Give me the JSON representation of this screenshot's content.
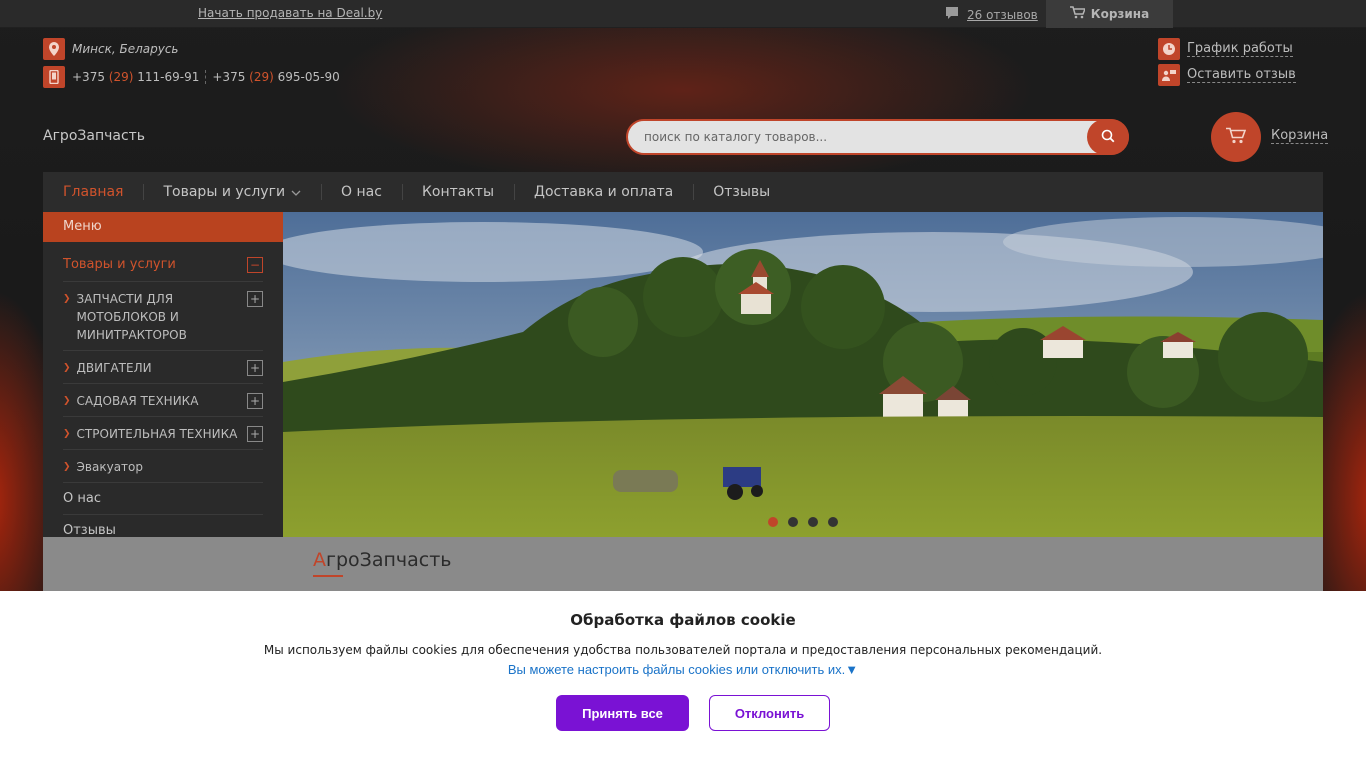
{
  "topbar": {
    "sell_link": "Начать продавать на Deal.by",
    "reviews_link": "26 отзывов",
    "cart": "Корзина"
  },
  "contacts": {
    "city": "Минск, Беларусь",
    "phone1_prefix": "+375",
    "phone1_code": "(29)",
    "phone1_number": "111-69-91",
    "phone2_prefix": "+375",
    "phone2_code": "(29)",
    "phone2_number": "695-05-90"
  },
  "links": {
    "schedule": "График работы",
    "leave_review": "Оставить отзыв"
  },
  "site_name": "АгроЗапчасть",
  "search": {
    "placeholder": "поиск по каталогу товаров..."
  },
  "cart_label": "Корзина",
  "nav": {
    "items": [
      {
        "label": "Главная"
      },
      {
        "label": "Товары и услуги"
      },
      {
        "label": "О нас"
      },
      {
        "label": "Контакты"
      },
      {
        "label": "Доставка и оплата"
      },
      {
        "label": "Отзывы"
      }
    ]
  },
  "sidebar": {
    "header": "Меню",
    "category": "Товары и услуги",
    "subitems": [
      {
        "label": "ЗАПЧАСТИ ДЛЯ МОТОБЛОКОВ И МИНИТРАКТОРОВ"
      },
      {
        "label": "ДВИГАТЕЛИ"
      },
      {
        "label": "САДОВАЯ ТЕХНИКА"
      },
      {
        "label": "СТРОИТЕЛЬНАЯ ТЕХНИКА"
      },
      {
        "label": "Эвакуатор"
      }
    ],
    "about": "О нас",
    "reviews": "Отзывы"
  },
  "slider": {
    "active_index": 0,
    "count": 4
  },
  "content": {
    "title_first": "А",
    "title_rest": "гроЗапчасть"
  },
  "cookie": {
    "title": "Обработка файлов cookie",
    "message": "Мы используем файлы cookies для обеспечения удобства пользователей портала и предоставления персональных рекомендаций.",
    "configure": "Вы можете настроить файлы cookies или отключить их.▼",
    "accept": "Принять все",
    "decline": "Отклонить"
  },
  "colors": {
    "accent": "#c0452a",
    "cookie_button": "#7a12d4",
    "cookie_link": "#1a73c8"
  }
}
